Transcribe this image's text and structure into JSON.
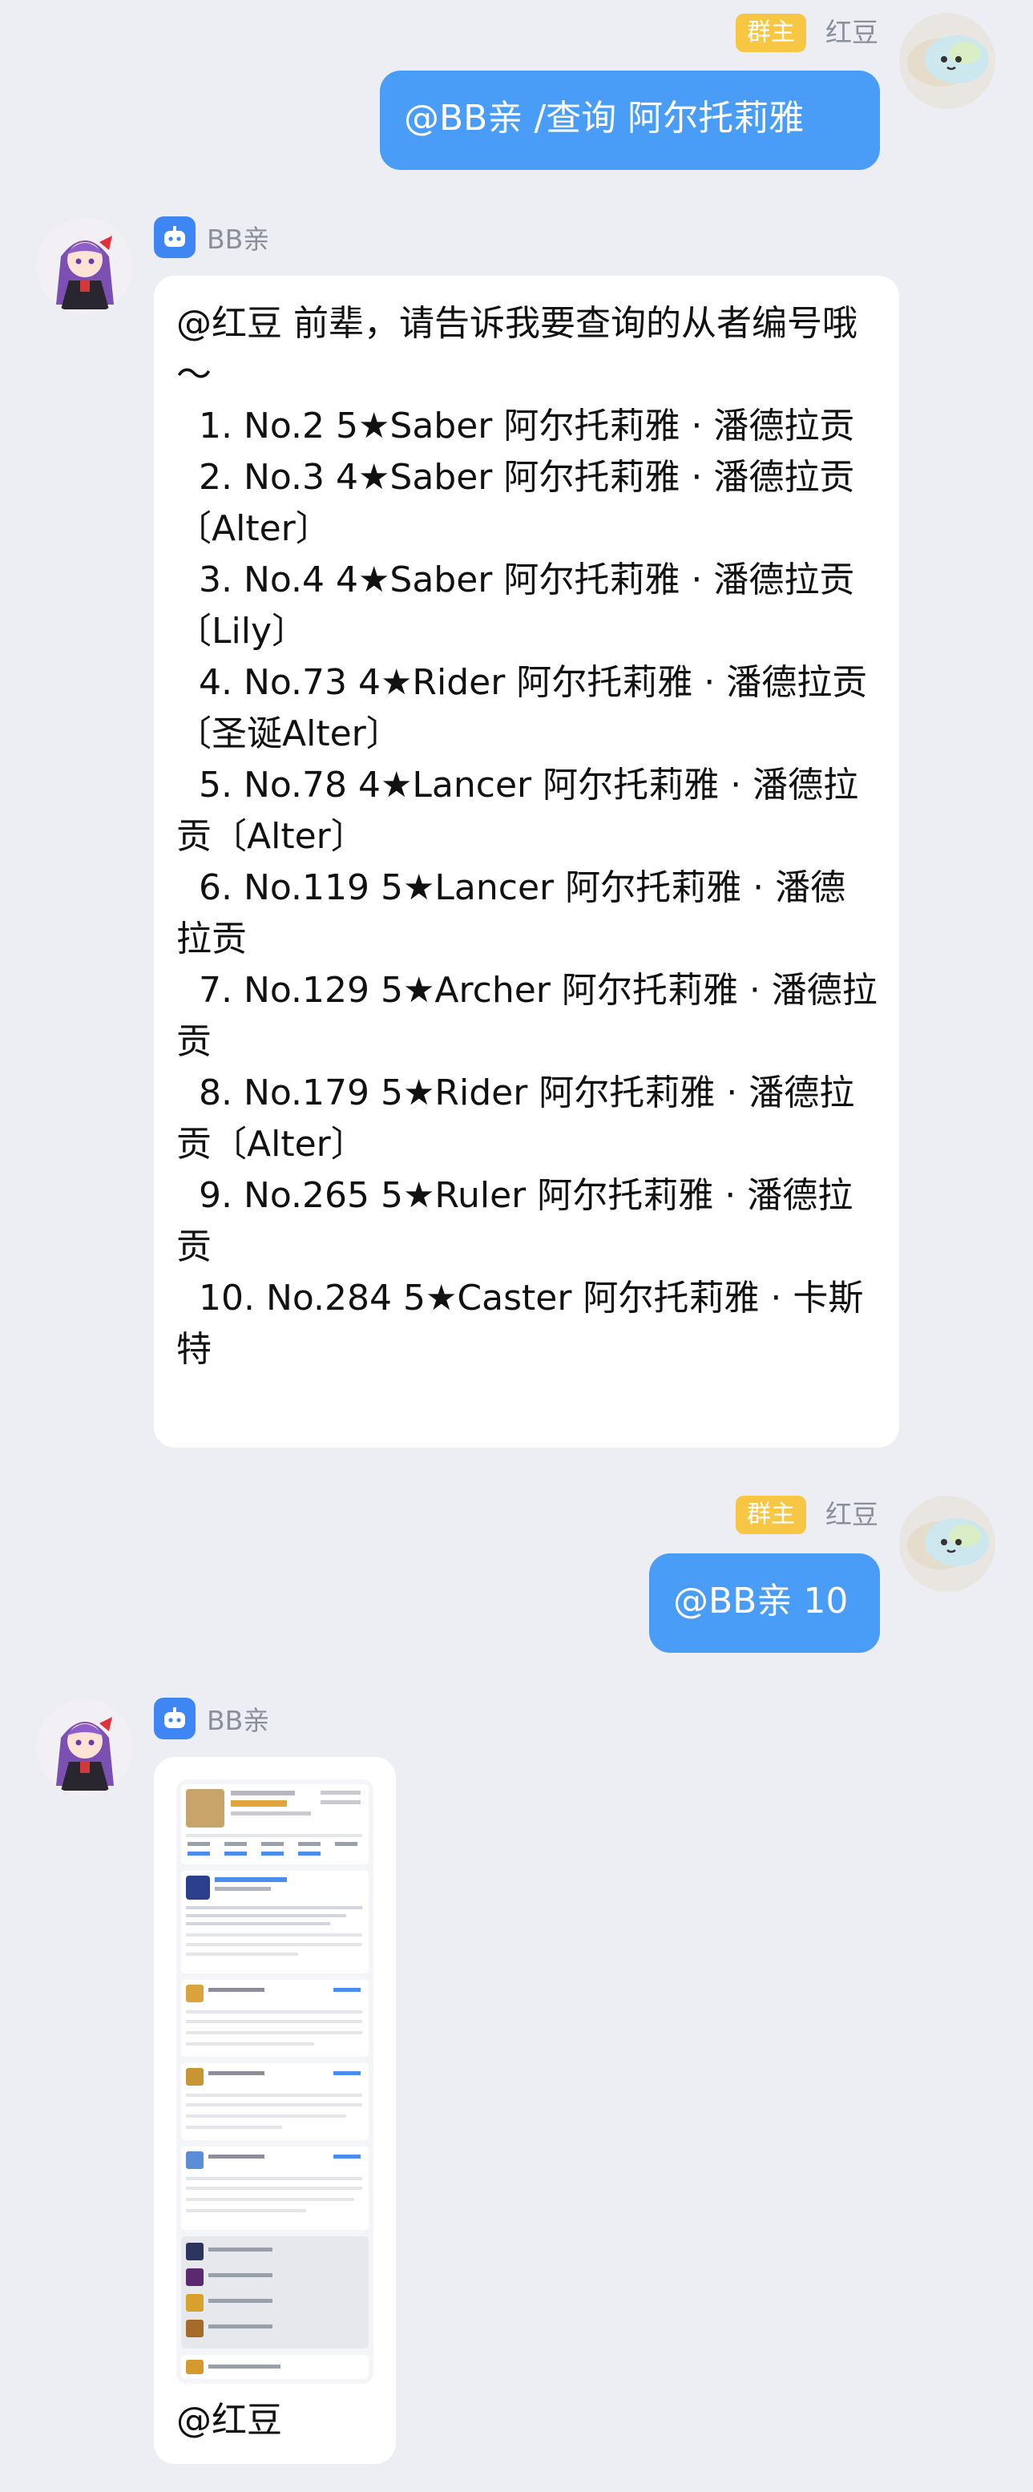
{
  "messages": {
    "user1": {
      "badge": "群主",
      "name": "红豆",
      "text": "@BB亲 /查询 阿尔托莉雅"
    },
    "bot1": {
      "name": "BB亲",
      "text": "@红豆 前辈，请告诉我要查询的从者编号哦～\n  1. No.2 5★Saber 阿尔托莉雅 · 潘德拉贡\n  2. No.3 4★Saber 阿尔托莉雅 · 潘德拉贡〔Alter〕\n  3. No.4 4★Saber 阿尔托莉雅 · 潘德拉贡〔Lily〕\n  4. No.73 4★Rider 阿尔托莉雅 · 潘德拉贡〔圣诞Alter〕\n  5. No.78 4★Lancer 阿尔托莉雅 · 潘德拉贡〔Alter〕\n  6. No.119 5★Lancer 阿尔托莉雅 · 潘德拉贡\n  7. No.129 5★Archer 阿尔托莉雅 · 潘德拉贡\n  8. No.179 5★Rider 阿尔托莉雅 · 潘德拉贡〔Alter〕\n  9. No.265 5★Ruler 阿尔托莉雅 · 潘德拉贡\n  10. No.284 5★Caster 阿尔托莉雅 · 卡斯特"
    },
    "user2": {
      "badge": "群主",
      "name": "红豆",
      "text": "@BB亲 10"
    },
    "bot2": {
      "name": "BB亲",
      "caption": "@红豆"
    }
  },
  "colors": {
    "background": "#eceef3",
    "user_bubble": "#4a9df7",
    "badge": "#f7c744",
    "bot_icon": "#3f86f5"
  },
  "icons": {
    "bot_badge": "robot-icon",
    "user_avatar": "mascot-avatar",
    "bot_avatar": "anime-girl-avatar"
  }
}
